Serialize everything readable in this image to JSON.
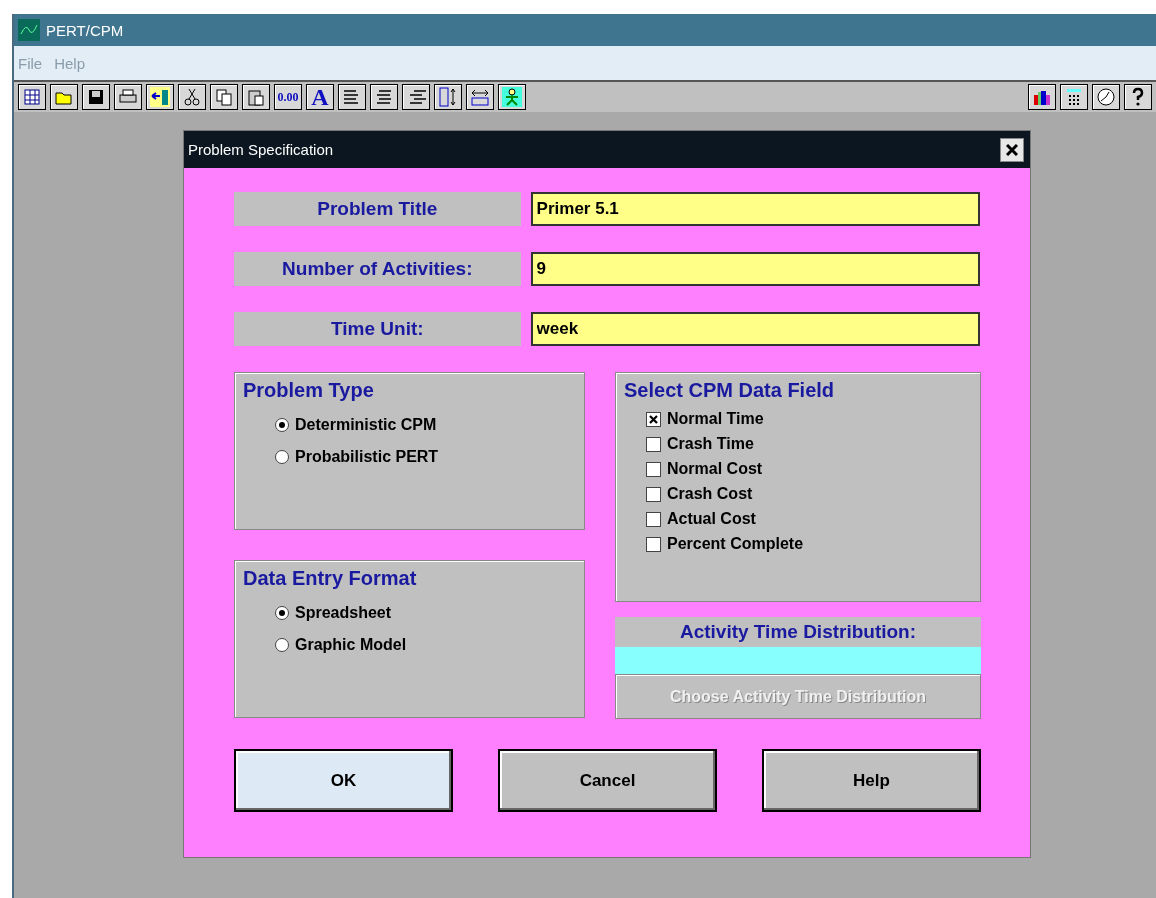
{
  "window": {
    "title": "PERT/CPM"
  },
  "menu": [
    {
      "label": "File"
    },
    {
      "label": "Help"
    }
  ],
  "toolbar": {
    "number_format_label": "0.00",
    "font_label": "A"
  },
  "dialog": {
    "title": "Problem Specification",
    "fields": [
      {
        "label": "Problem Title",
        "value": "Primer 5.1"
      },
      {
        "label": "Number of Activities:",
        "value": "9"
      },
      {
        "label": "Time Unit:",
        "value": "week"
      }
    ],
    "problem_type": {
      "title": "Problem Type",
      "options": [
        {
          "label": "Deterministic CPM",
          "selected": true
        },
        {
          "label": "Probabilistic PERT",
          "selected": false
        }
      ]
    },
    "data_entry_format": {
      "title": "Data Entry Format",
      "options": [
        {
          "label": "Spreadsheet",
          "selected": true
        },
        {
          "label": "Graphic Model",
          "selected": false
        }
      ]
    },
    "cpm_data_field": {
      "title": "Select CPM Data Field",
      "options": [
        {
          "label": "Normal Time",
          "checked": true
        },
        {
          "label": "Crash Time",
          "checked": false
        },
        {
          "label": "Normal Cost",
          "checked": false
        },
        {
          "label": "Crash Cost",
          "checked": false
        },
        {
          "label": "Actual Cost",
          "checked": false
        },
        {
          "label": "Percent Complete",
          "checked": false
        }
      ]
    },
    "activity_time_distribution": {
      "label": "Activity Time Distribution:",
      "button": "Choose Activity Time Distribution",
      "disabled": true
    },
    "buttons": [
      {
        "label": "OK",
        "default": true
      },
      {
        "label": "Cancel",
        "default": false
      },
      {
        "label": "Help",
        "default": false
      }
    ]
  }
}
